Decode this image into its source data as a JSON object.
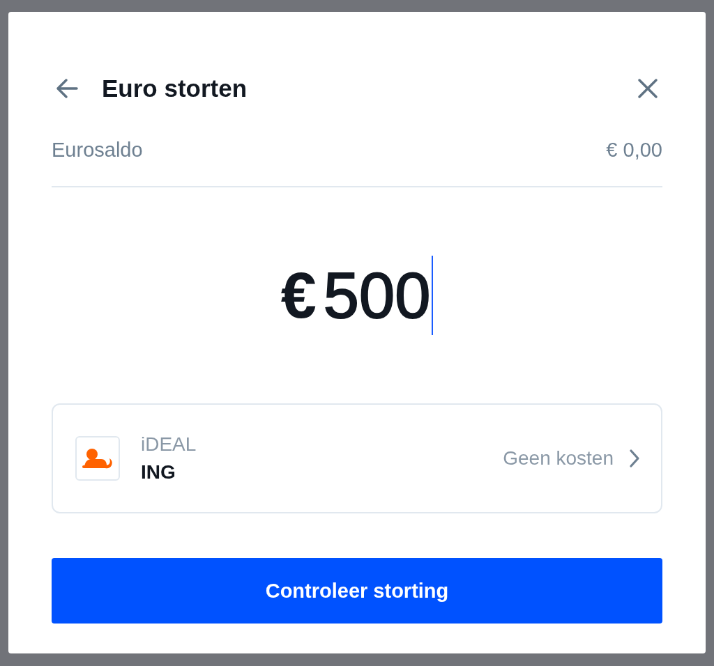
{
  "dialog": {
    "title": "Euro storten"
  },
  "balance": {
    "label": "Eurosaldo",
    "value": "€ 0,00"
  },
  "amount": {
    "currency": "€",
    "value": "500"
  },
  "payment_method": {
    "method": "iDEAL",
    "bank": "ING",
    "fee": "Geen kosten"
  },
  "primary_button": {
    "label": "Controleer storting"
  }
}
